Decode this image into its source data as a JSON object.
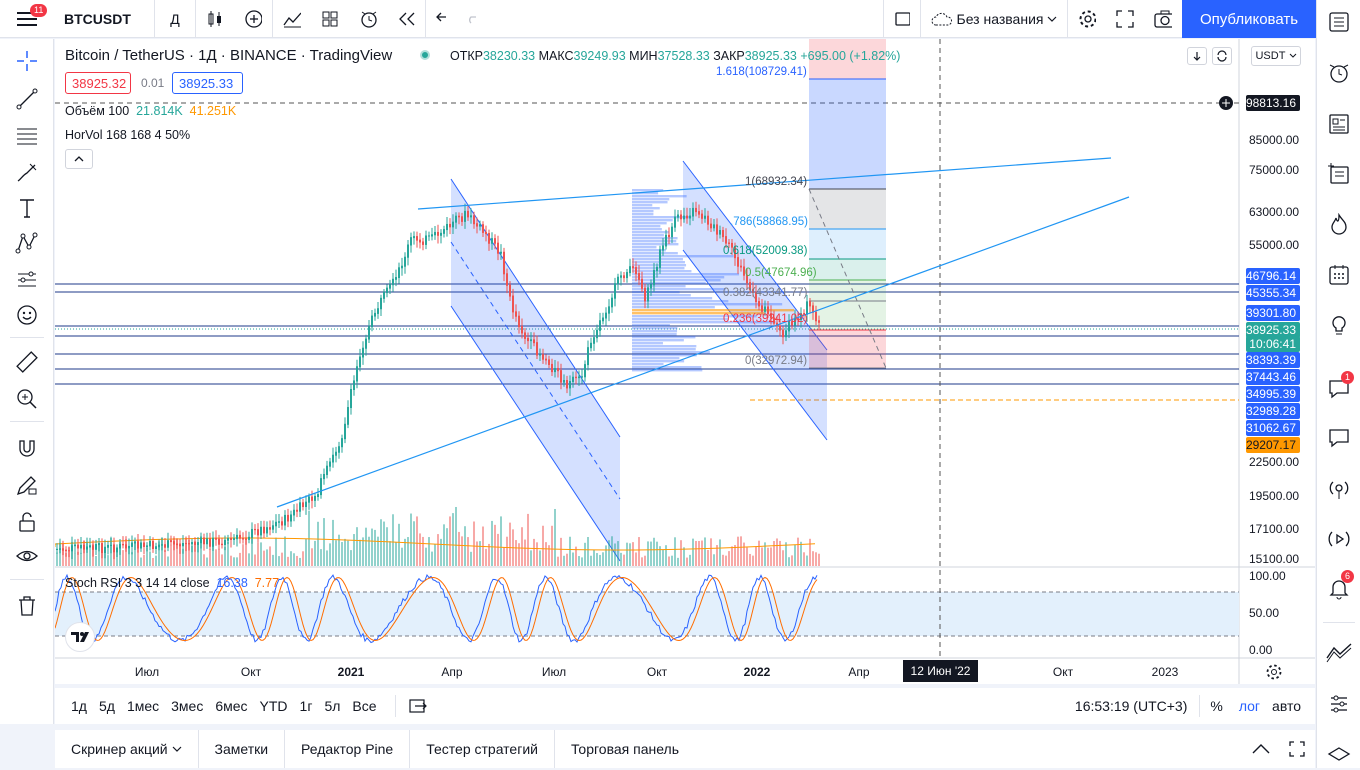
{
  "topbar": {
    "menu_badge": "11",
    "symbol": "BTCUSDT",
    "interval": "Д",
    "layout_name": "Без названия",
    "publish_label": "Опубликовать"
  },
  "legend": {
    "title": "Bitcoin / TetherUS · 1Д · BINANCE · TradingView",
    "open_label": "ОТКР",
    "open": "38230.33",
    "high_label": "МАКС",
    "high": "39249.93",
    "low_label": "МИН",
    "low": "37528.33",
    "close_label": "ЗАКР",
    "close": "38925.33",
    "change": "+695.00 (+1.82%)",
    "bid": "38925.32",
    "spread": "0.01",
    "ask": "38925.33",
    "volume_label": "Объём 100",
    "volume_v1": "21.814K",
    "volume_v2": "41.251K",
    "horvol": "HorVol 168 168 4 50%",
    "collapse_icon": "chevron-up-icon",
    "currency": "USDT"
  },
  "fib": [
    {
      "text": "1.618(108729.41)",
      "color": "#2962ff"
    },
    {
      "text": "1(68932.34)",
      "color": "#434651"
    },
    {
      "text": ".786(58868.95)",
      "color": "#2196f3"
    },
    {
      "text": "0.618(52009.38)",
      "color": "#089981"
    },
    {
      "text": "0.5(47674.96)",
      "color": "#4caf50"
    },
    {
      "text": "0.382(43341.77)",
      "color": "#787b86"
    },
    {
      "text": "0.236(39241.02)",
      "color": "#f23645"
    },
    {
      "text": "0(32972.94)",
      "color": "#787b86"
    }
  ],
  "price_scale": {
    "ticks": [
      "85000.00",
      "75000.00",
      "63000.00",
      "55000.00",
      "22500.00",
      "19500.00",
      "17100.00",
      "15100.00"
    ],
    "crosshair_price": "98813.16",
    "labels": [
      {
        "text": "46796.14",
        "color": "#2962ff"
      },
      {
        "text": "45355.34",
        "color": "#2962ff"
      },
      {
        "text": "39301.80",
        "color": "#2962ff"
      },
      {
        "text": "38925.33",
        "color": "#26a69a"
      },
      {
        "text": "10:06:41",
        "color": "#26a69a"
      },
      {
        "text": "38393.39",
        "color": "#2962ff"
      },
      {
        "text": "37443.46",
        "color": "#2962ff"
      },
      {
        "text": "34995.39",
        "color": "#2962ff"
      },
      {
        "text": "32989.28",
        "color": "#2962ff"
      },
      {
        "text": "31062.67",
        "color": "#2962ff"
      },
      {
        "text": "29207.17",
        "color": "#ff9800"
      }
    ]
  },
  "stoch": {
    "label": "Stoch RSI 3 3 14 14 close",
    "k": "16.38",
    "d": "7.77",
    "ticks": [
      "100.00",
      "50.00",
      "0.00"
    ]
  },
  "time_axis": {
    "labels": [
      "Июл",
      "Окт",
      "2021",
      "Апр",
      "Июл",
      "Окт",
      "2022",
      "Апр",
      "Окт",
      "2023"
    ],
    "crosshair_date": "12 Июн '22"
  },
  "bottombar": {
    "ranges": [
      "1д",
      "5д",
      "1мес",
      "3мес",
      "6мес",
      "YTD",
      "1г",
      "5л",
      "Все"
    ],
    "time": "16:53:19 (UTC+3)",
    "percent": "%",
    "log": "лог",
    "auto": "авто"
  },
  "panel_tabs": [
    "Скринер акций",
    "Заметки",
    "Редактор Pine",
    "Тестер стратегий",
    "Торговая панель"
  ],
  "right_badges": {
    "chat": "1",
    "alerts": "6"
  }
}
